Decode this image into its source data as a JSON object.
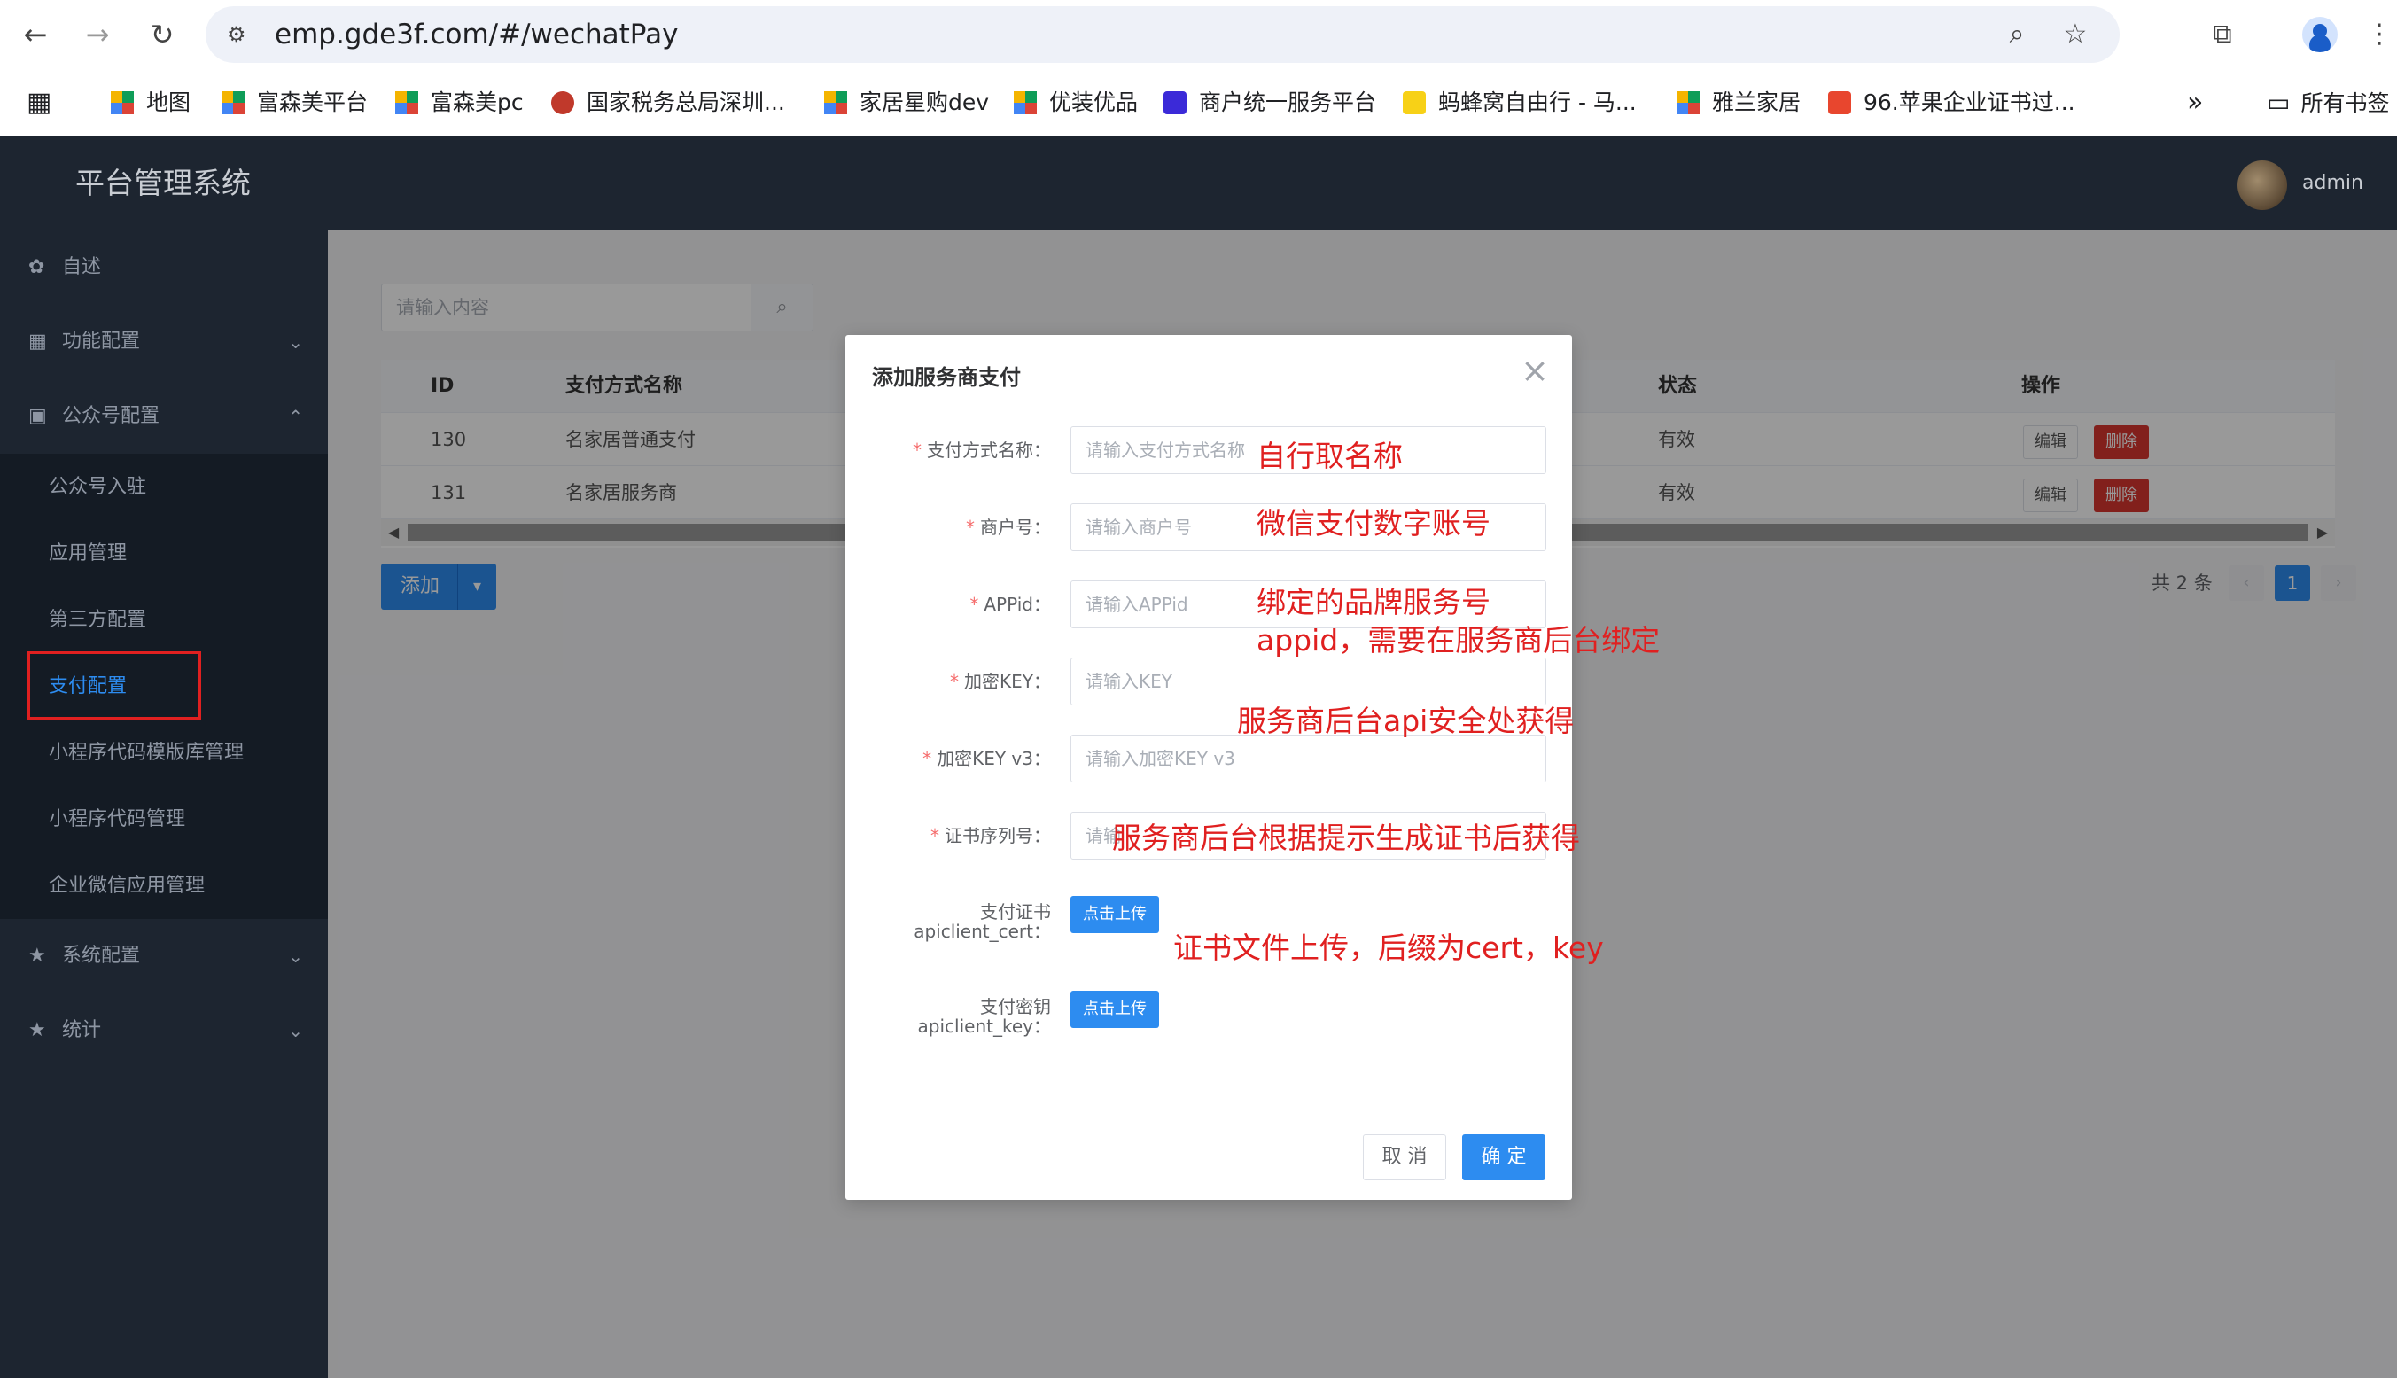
{
  "browser": {
    "url": "emp.gde3f.com/#/wechatPay",
    "bookmarks": [
      "地图",
      "富森美平台",
      "富森美pc",
      "国家税务总局深圳...",
      "家居星购dev",
      "优装优品",
      "商户统一服务平台",
      "蚂蜂窝自由行 - 马...",
      "雅兰家居",
      "96.苹果企业证书过..."
    ],
    "more_label": "»",
    "all_bookmarks": "所有书签"
  },
  "app": {
    "title": "平台管理系统",
    "user": "admin"
  },
  "sidebar": {
    "items": [
      {
        "label": "自述",
        "icon": "gear-icon"
      },
      {
        "label": "功能配置",
        "icon": "grid-icon"
      },
      {
        "label": "公众号配置",
        "icon": "calendar-icon"
      },
      {
        "label": "系统配置",
        "icon": "star-icon"
      },
      {
        "label": "统计",
        "icon": "star-icon"
      }
    ],
    "submenu": [
      "公众号入驻",
      "应用管理",
      "第三方配置",
      "支付配置",
      "小程序代码模版库管理",
      "小程序代码管理",
      "企业微信应用管理"
    ]
  },
  "main": {
    "search_placeholder": "请输入内容",
    "table": {
      "headers": [
        "ID",
        "支付方式名称",
        "状态",
        "操作"
      ],
      "rows": [
        {
          "id": "130",
          "name": "名家居普通支付",
          "status": "有效"
        },
        {
          "id": "131",
          "name": "名家居服务商",
          "status": "有效"
        }
      ],
      "edit_label": "编辑",
      "delete_label": "删除"
    },
    "add_label": "添加",
    "pagination": {
      "total": "共 2 条",
      "current": "1"
    }
  },
  "dialog": {
    "title": "添加服务商支付",
    "fields": [
      {
        "label": "支付方式名称：",
        "placeholder": "请输入支付方式名称",
        "required": true
      },
      {
        "label": "商户号：",
        "placeholder": "请输入商户号",
        "required": true
      },
      {
        "label": "APPid：",
        "placeholder": "请输入APPid",
        "required": true
      },
      {
        "label": "加密KEY：",
        "placeholder": "请输入KEY",
        "required": true
      },
      {
        "label": "加密KEY v3：",
        "placeholder": "请输入加密KEY v3",
        "required": true
      },
      {
        "label": "证书序列号：",
        "placeholder": "请输",
        "required": true
      }
    ],
    "uploads": [
      {
        "label1": "支付证书",
        "label2": "apiclient_cert：",
        "button": "点击上传"
      },
      {
        "label1": "支付密钥",
        "label2": "apiclient_key：",
        "button": "点击上传"
      }
    ],
    "cancel_label": "取 消",
    "ok_label": "确 定"
  },
  "annotations": [
    "自行取名称",
    "微信支付数字账号",
    "绑定的品牌服务号",
    "appid，需要在服务商后台绑定",
    "服务商后台api安全处获得",
    "服务商后台根据提示生成证书后获得",
    "证书文件上传，后缀为cert，key"
  ],
  "colors": {
    "primary": "#2d8cf0",
    "danger": "#d9362f",
    "sidebar": "#1d2530",
    "annotation": "#e02020"
  }
}
